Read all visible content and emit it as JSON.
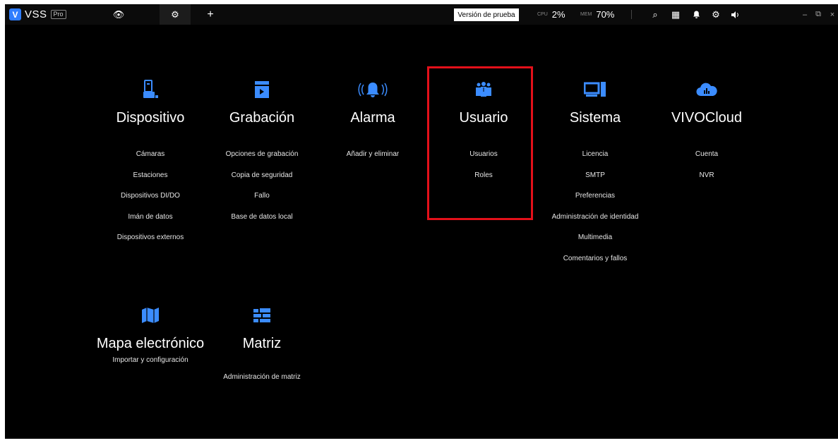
{
  "app": {
    "logo_text": "VSS",
    "edition_badge": "Pro"
  },
  "topbar": {
    "trial_label": "Versión de prueba",
    "cpu_label": "CPU",
    "cpu_value": "2%",
    "mem_label": "MEM",
    "mem_value": "70%"
  },
  "categories": [
    {
      "title": "Dispositivo",
      "icon": "device-icon",
      "items": [
        "Cámaras",
        "Estaciones",
        "Dispositivos DI/DO",
        "Imán de datos",
        "Dispositivos externos"
      ]
    },
    {
      "title": "Grabación",
      "icon": "recording-icon",
      "items": [
        "Opciones de grabación",
        "Copia de seguridad",
        "Fallo",
        "Base de datos local"
      ]
    },
    {
      "title": "Alarma",
      "icon": "alarm-bell-icon",
      "items": [
        "Añadir y eliminar"
      ]
    },
    {
      "title": "Usuario",
      "icon": "users-icon",
      "items": [
        "Usuarios",
        "Roles"
      ]
    },
    {
      "title": "Sistema",
      "icon": "system-computer-icon",
      "items": [
        "Licencia",
        "SMTP",
        "Preferencias",
        "Administración de identidad",
        "Multimedia",
        "Comentarios y fallos"
      ]
    },
    {
      "title": "VIVOCloud",
      "icon": "cloud-icon",
      "items": [
        "Cuenta",
        "NVR"
      ]
    },
    {
      "title": "Mapa electrónico",
      "icon": "map-icon",
      "items": [
        "Importar y configuración"
      ]
    },
    {
      "title": "Matriz",
      "icon": "matrix-grid-icon",
      "items": [
        "Administración de matriz"
      ]
    }
  ],
  "colors": {
    "accent": "#3b8cff",
    "highlight": "#e3101a",
    "background": "#000000"
  }
}
